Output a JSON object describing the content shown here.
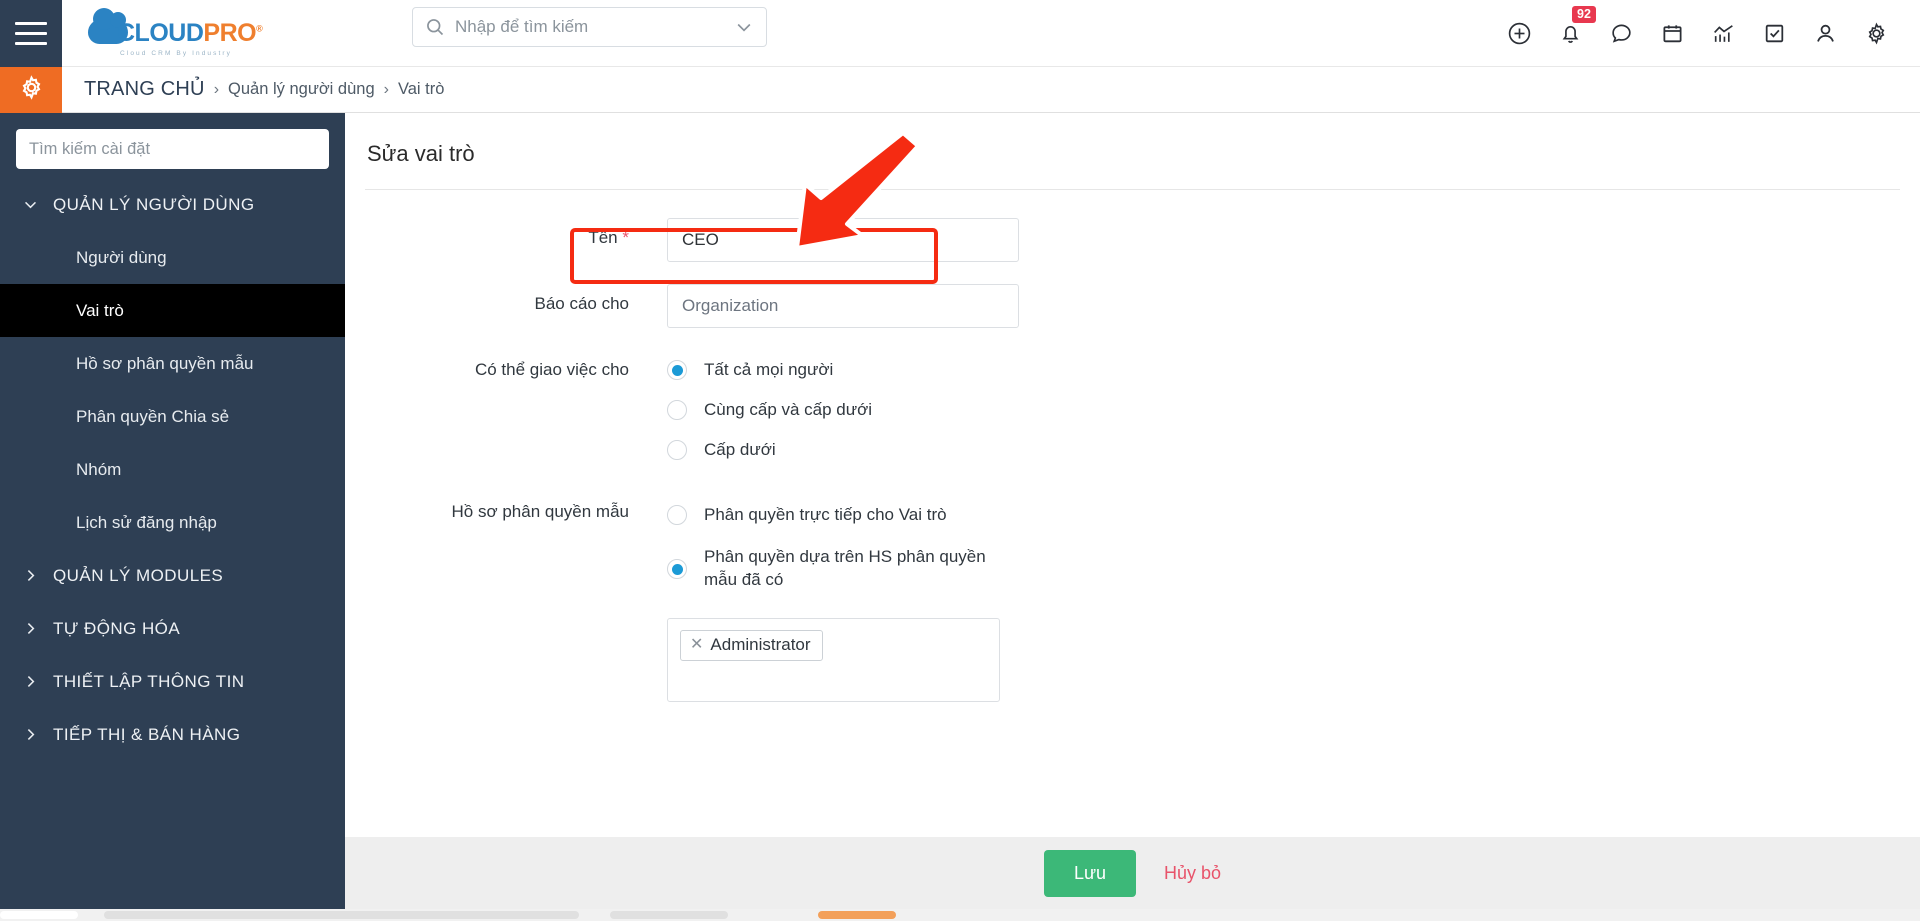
{
  "brand": {
    "name_part1": "CLOUD",
    "name_part2": "PRO",
    "registered": "®",
    "tagline": "Cloud CRM By Industry"
  },
  "topbar": {
    "menu_icon": "hamburger-icon",
    "search": {
      "placeholder": "Nhập để tìm kiếm",
      "icon": "search-icon",
      "caret": "chevron-down-icon"
    },
    "icons": [
      {
        "name": "plus-circle-icon",
        "badge": null
      },
      {
        "name": "bell-icon",
        "badge": "92"
      },
      {
        "name": "chat-bubble-icon",
        "badge": null
      },
      {
        "name": "calendar-icon",
        "badge": null
      },
      {
        "name": "analytics-chart-icon",
        "badge": null
      },
      {
        "name": "checkbox-task-icon",
        "badge": null
      },
      {
        "name": "user-account-icon",
        "badge": null
      },
      {
        "name": "settings-gear-icon",
        "badge": null
      }
    ]
  },
  "breadcrumb": {
    "settings_icon": "gear-icon",
    "home": "TRANG CHỦ",
    "separator": "›",
    "items": [
      "Quản lý người dùng",
      "Vai trò"
    ]
  },
  "sidebar": {
    "search_placeholder": "Tìm kiếm cài đặt",
    "groups": [
      {
        "label": "QUẢN LÝ NGƯỜI DÙNG",
        "expanded": true,
        "items": [
          {
            "label": "Người dùng",
            "active": false
          },
          {
            "label": "Vai trò",
            "active": true
          },
          {
            "label": "Hồ sơ phân quyền mẫu",
            "active": false
          },
          {
            "label": "Phân quyền Chia sẻ",
            "active": false
          },
          {
            "label": "Nhóm",
            "active": false
          },
          {
            "label": "Lịch sử đăng nhập",
            "active": false
          }
        ]
      },
      {
        "label": "QUẢN LÝ MODULES",
        "expanded": false,
        "items": []
      },
      {
        "label": "TỰ ĐỘNG HÓA",
        "expanded": false,
        "items": []
      },
      {
        "label": "THIẾT LẬP THÔNG TIN",
        "expanded": false,
        "items": []
      },
      {
        "label": "TIẾP THỊ & BÁN HÀNG",
        "expanded": false,
        "items": []
      }
    ]
  },
  "main": {
    "page_title": "Sửa vai trò",
    "fields": {
      "name": {
        "label": "Tên",
        "required_mark": "*",
        "value": "CEO",
        "highlighted": true
      },
      "reports_to": {
        "label": "Báo cáo cho",
        "value": "Organization"
      },
      "assign_to": {
        "label": "Có thể giao việc cho",
        "options": [
          {
            "label": "Tất cả mọi người",
            "selected": true
          },
          {
            "label": "Cùng cấp và cấp dưới",
            "selected": false
          },
          {
            "label": "Cấp dưới",
            "selected": false
          }
        ]
      },
      "profile": {
        "label": "Hồ sơ phân quyền mẫu",
        "options": [
          {
            "label": "Phân quyền trực tiếp cho Vai trò",
            "selected": false
          },
          {
            "label": "Phân quyền dựa trên HS phân quyền mẫu đã có",
            "selected": true
          }
        ],
        "tags": [
          {
            "label": "Administrator",
            "remove_icon": "close-icon"
          }
        ]
      }
    }
  },
  "footer": {
    "save_label": "Lưu",
    "cancel_label": "Hủy bỏ"
  },
  "colors": {
    "sidebar_bg": "#2e3f54",
    "accent_orange": "#ef6c23",
    "brand_blue": "#2b83c3",
    "save_green": "#3cb878",
    "danger_red": "#e8536a",
    "badge_red": "#e8384f",
    "radio_blue": "#1b9ad6",
    "highlight_red": "#f52b12"
  }
}
